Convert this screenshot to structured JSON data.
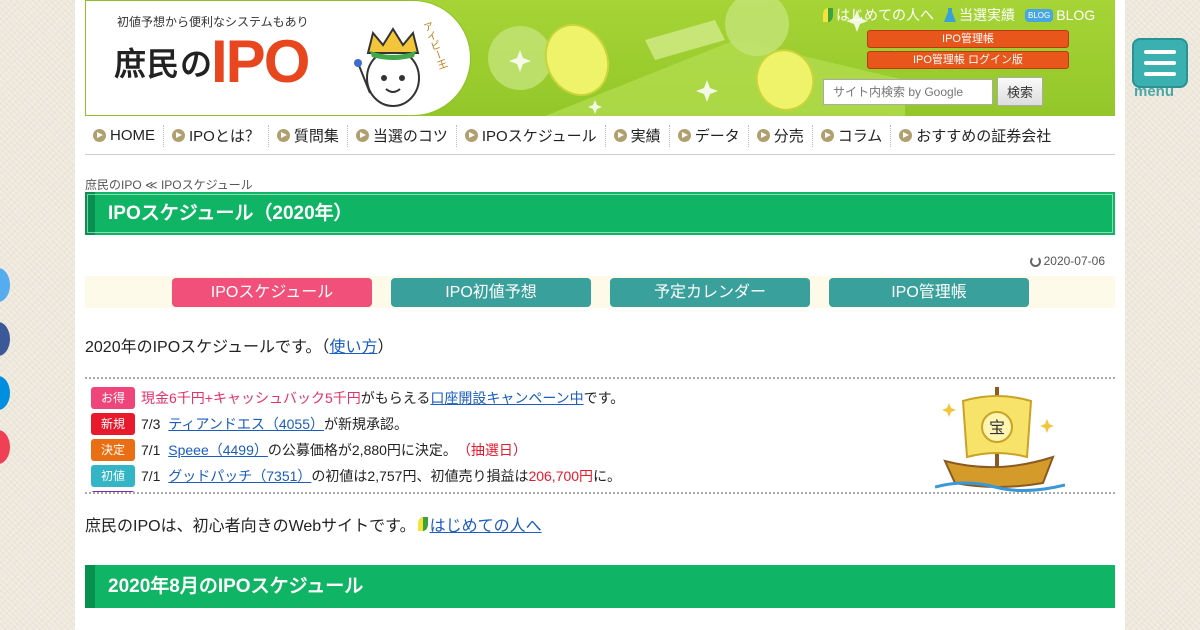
{
  "header": {
    "tagline": "初値予想から便利なシステムもあり",
    "logo_text": "庶民の",
    "logo_ipo": "IPO",
    "mascot_label": "アイピー王",
    "top_links": [
      {
        "label": "はじめての人へ",
        "icon": "beginner-leaf-icon"
      },
      {
        "label": "当選実績",
        "icon": "flask-icon"
      },
      {
        "label": "BLOG",
        "icon": "blog-badge-icon",
        "badge": "BLOG"
      }
    ],
    "mgmt_button": "IPO管理帳",
    "mgmt_login_button": "IPO管理帳 ログイン版",
    "search": {
      "placeholder": "サイト内検索 by Google",
      "button": "検索"
    }
  },
  "nav": [
    "HOME",
    "IPOとは？",
    "質問集",
    "当選のコツ",
    "IPOスケジュール",
    "実績",
    "データ",
    "分売",
    "コラム",
    "おすすめの証券会社"
  ],
  "breadcrumb": {
    "home": "庶民のIPO",
    "separator": "≪",
    "current": "IPOスケジュール"
  },
  "page_title": "IPOスケジュール（2020年）",
  "date": "2020-07-06",
  "tabs": [
    {
      "label": "IPOスケジュール",
      "active": true
    },
    {
      "label": "IPO初値予想",
      "active": false
    },
    {
      "label": "予定カレンダー",
      "active": false
    },
    {
      "label": "IPO管理帳",
      "active": false
    }
  ],
  "intro": {
    "text": "2020年のIPOスケジュールです。（",
    "link": "使い方",
    "close": "）"
  },
  "news": [
    {
      "badge": "お得",
      "color": "#f0457a",
      "parts": {
        "a": "現金6千円+キャッシュバック5千円",
        "b": "がもらえる",
        "link": "口座開設キャンペーン中",
        "c": "です。"
      }
    },
    {
      "badge": "新規",
      "color": "#e8182d",
      "date": "7/3",
      "link": "ティアンドエス（4055）",
      "text": "が新規承認。"
    },
    {
      "badge": "決定",
      "color": "#ea6f14",
      "date": "7/1",
      "link": "Speee（4499）",
      "text": "の公募価格が2,880円に決定。",
      "extra": "（抽選日）"
    },
    {
      "badge": "初値",
      "color": "#33b5c5",
      "date": "7/1",
      "link": "グッドパッチ（7351）",
      "text": "の初値は2,757円、初値売り損益は",
      "amount": "206,700円",
      "tail": "に。"
    }
  ],
  "treasure_label": "宝",
  "beginner": {
    "text": "庶民のIPOは、初心者向きのWebサイトです。",
    "link": "はじめての人へ"
  },
  "section_title": "2020年8月のIPOスケジュール",
  "menu_label": "menu",
  "colors": {
    "green": "#0fb464",
    "pink": "#f0507a",
    "teal": "#3aa09b",
    "lime": "#a6d437"
  }
}
